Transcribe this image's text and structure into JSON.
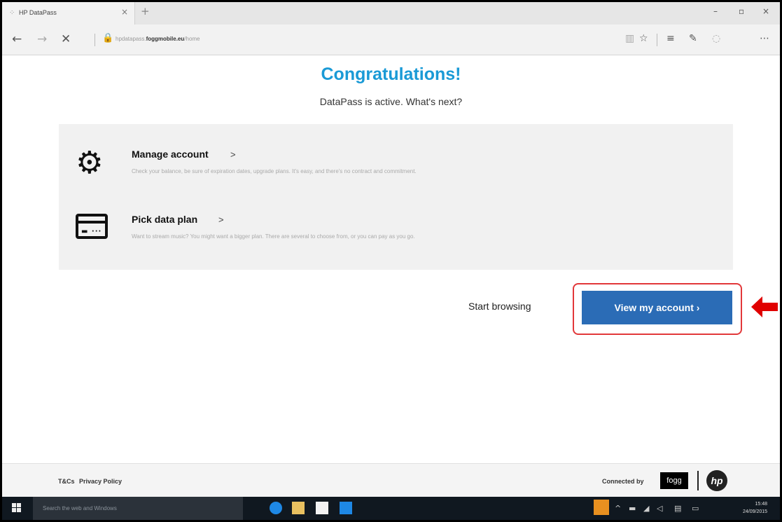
{
  "browser": {
    "tab_title": "HP DataPass",
    "tab_close": "×",
    "new_tab": "+",
    "url_prefix": "hpdatapass.",
    "url_domain": "foggmobile.eu",
    "url_suffix": "/home",
    "icons": [
      "back-icon",
      "forward-icon",
      "stop-icon",
      "lock-icon",
      "reading-view-icon",
      "favorite-star-icon",
      "hub-icon",
      "web-note-icon",
      "share-icon",
      "more-icon"
    ]
  },
  "window": {
    "minimize": "–",
    "maximize": "▫",
    "close": "×"
  },
  "page": {
    "title": "Congratulations!",
    "subtitle": "DataPass is active. What's next?",
    "options": [
      {
        "title": "Manage account",
        "chevron": ">",
        "description": "Check your balance, be sure of expiration dates, upgrade plans. It's easy, and there's no contract and commitment.",
        "icon": "gear-icon"
      },
      {
        "title": "Pick data plan",
        "chevron": ">",
        "description": "Want to stream music? You might want a bigger plan. There are several to choose from, or you can pay as you go.",
        "icon": "credit-card-icon"
      }
    ],
    "start_browsing": "Start browsing",
    "primary_button": "View my account ›",
    "colors": {
      "heading": "#1a9ad6",
      "button": "#2b6cb6",
      "highlight": "#e2383a",
      "arrow": "#e00000"
    }
  },
  "footer": {
    "tcs": "T&Cs",
    "privacy": "Privacy Policy",
    "connected_by": "Connected by",
    "fogg": "fogg",
    "hp": "hp"
  },
  "taskbar": {
    "search_placeholder": "Search the web and Windows",
    "time": "15:48",
    "date": "24/09/2015"
  }
}
